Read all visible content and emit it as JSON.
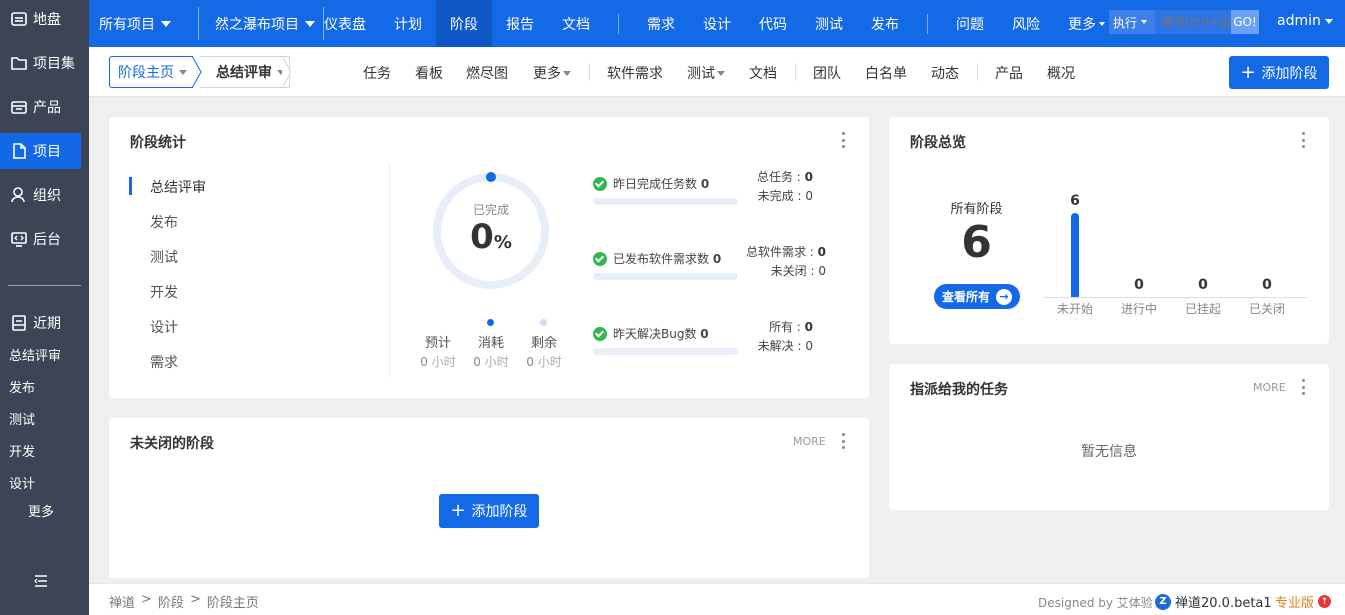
{
  "left_nav": {
    "items": [
      {
        "label": "地盘",
        "icon": "home-icon"
      },
      {
        "label": "项目集",
        "icon": "folder-icon"
      },
      {
        "label": "产品",
        "icon": "product-icon"
      },
      {
        "label": "项目",
        "icon": "file-icon",
        "active": true
      },
      {
        "label": "组织",
        "icon": "user-icon"
      },
      {
        "label": "后台",
        "icon": "monitor-icon"
      }
    ],
    "recent_label": "近期",
    "recent_items": [
      "总结评审",
      "发布",
      "测试",
      "开发",
      "设计"
    ],
    "more_label": "更多"
  },
  "topbar": {
    "crumb_all_projects": "所有项目",
    "crumb_project": "然之瀑布项目",
    "nav_group1": [
      "仪表盘",
      "计划",
      "阶段",
      "报告",
      "文档"
    ],
    "active_nav": "阶段",
    "nav_group2": [
      "需求",
      "设计",
      "代码",
      "测试",
      "发布"
    ],
    "nav_group3": [
      "问题",
      "风险",
      "更多"
    ],
    "search_type": "执行",
    "search_placeholder": "编号(ctrl+g)",
    "search_go": "GO!",
    "user": "admin"
  },
  "subbar": {
    "crumb_home": "阶段主页",
    "crumb_stage": "总结评审",
    "nav": [
      "任务",
      "看板",
      "燃尽图",
      "更多",
      "软件需求",
      "测试",
      "文档",
      "团队",
      "白名单",
      "动态",
      "产品",
      "概况"
    ],
    "add_button": "添加阶段"
  },
  "stats_card": {
    "title": "阶段统计",
    "stages": [
      "总结评审",
      "发布",
      "测试",
      "开发",
      "设计",
      "需求"
    ],
    "active_stage": "总结评审",
    "progress_label": "已完成",
    "progress_value": "0",
    "progress_unit": "%",
    "progress_fraction": 0,
    "hours": [
      {
        "label": "预计",
        "value": "0",
        "unit": "小时"
      },
      {
        "label": "消耗",
        "value": "0",
        "unit": "小时"
      },
      {
        "label": "剩余",
        "value": "0",
        "unit": "小时"
      }
    ],
    "stat_rows": [
      {
        "label": "昨日完成任务数",
        "value": "0",
        "right": [
          {
            "k": "总任务",
            "v": "0"
          },
          {
            "k": "未完成",
            "v": "0"
          }
        ]
      },
      {
        "label": "已发布软件需求数",
        "value": "0",
        "right": [
          {
            "k": "总软件需求",
            "v": "0"
          },
          {
            "k": "未关闭",
            "v": "0"
          }
        ]
      },
      {
        "label": "昨天解决Bug数",
        "value": "0",
        "right": [
          {
            "k": "所有",
            "v": "0"
          },
          {
            "k": "未解决",
            "v": "0"
          }
        ]
      }
    ]
  },
  "overview_card": {
    "title": "阶段总览",
    "all_label": "所有阶段",
    "all_value": "6",
    "view_all": "查看所有"
  },
  "chart_data": {
    "type": "bar",
    "categories": [
      "未开始",
      "进行中",
      "已挂起",
      "已关闭"
    ],
    "values": [
      6,
      0,
      0,
      0
    ],
    "title": "",
    "xlabel": "",
    "ylabel": "",
    "ylim": [
      0,
      6
    ],
    "grid": false,
    "color": "#1369e6"
  },
  "open_stages_card": {
    "title": "未关闭的阶段",
    "more": "MORE",
    "add_button": "添加阶段"
  },
  "tasks_card": {
    "title": "指派给我的任务",
    "more": "MORE",
    "empty": "暂无信息"
  },
  "footer": {
    "breadcrumb": [
      "禅道",
      "阶段",
      "阶段主页"
    ],
    "sep": ">",
    "designed_by": "Designed by",
    "designer": "艾体验",
    "version": "禅道20.0.beta1",
    "edition": "专业版"
  },
  "colors": {
    "primary": "#1369e6",
    "sidebar": "#3d4456",
    "success": "#2fb84f",
    "edition": "#e67e22",
    "alert": "#e53935"
  }
}
